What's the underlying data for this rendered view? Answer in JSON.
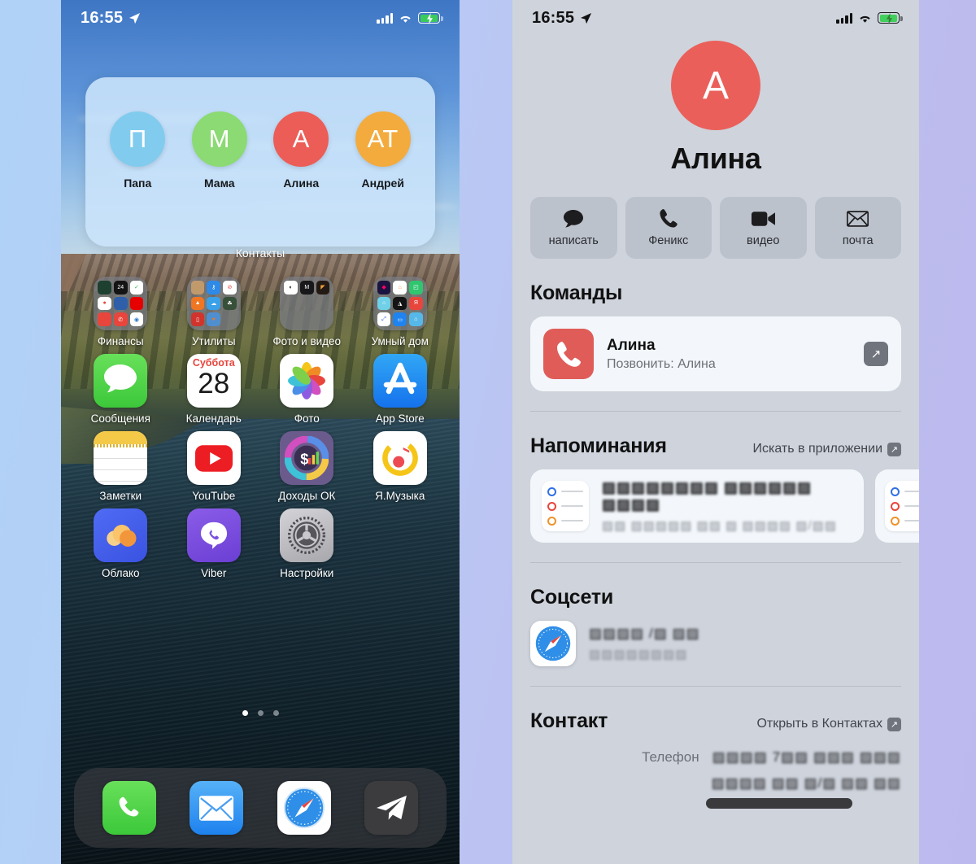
{
  "background": {
    "left_color": "#b0d2f7",
    "right_color": "#bcb9ef"
  },
  "home_screen": {
    "statusbar": {
      "time": "16:55",
      "location_icon": "location-arrow-icon",
      "signal_icon": "cellular-bars-icon",
      "wifi_icon": "wifi-icon",
      "battery_icon": "battery-charging-icon"
    },
    "widget": {
      "label": "Контакты",
      "contacts": [
        {
          "initials": "П",
          "name": "Папа",
          "color": "#81ccee"
        },
        {
          "initials": "М",
          "name": "Мама",
          "color": "#8bda74"
        },
        {
          "initials": "А",
          "name": "Алина",
          "color": "#ec5d58"
        },
        {
          "initials": "АТ",
          "name": "Андрей",
          "color": "#f3ab3e"
        }
      ]
    },
    "rows": [
      [
        {
          "label": "Финансы",
          "type": "folder",
          "minis": [
            "#1d4030",
            "#141414",
            "#ffffff",
            "#e8453c",
            "#2f5fa8",
            "#e60000",
            "#e8453c",
            "#e8453c",
            "#ffffff"
          ]
        },
        {
          "label": "Утилиты",
          "type": "folder",
          "minis": [
            "#c19a6b",
            "#2e8ae6",
            "#ffffff",
            "#ef7622",
            "#3aa0e8",
            "#37503a",
            "#d0342c",
            "#4f8fd0",
            "transparent"
          ]
        },
        {
          "label": "Фото и видео",
          "type": "folder",
          "minis": [
            "#ffffff",
            "#18181a",
            "#241a14",
            "transparent",
            "transparent",
            "transparent",
            "transparent",
            "transparent",
            "transparent"
          ]
        },
        {
          "label": "Умный дом",
          "type": "folder",
          "minis": [
            "#1b1340",
            "#ffffff",
            "#30c56f",
            "#6fd0e8",
            "#141414",
            "#e8453c",
            "#ffffff",
            "#1f83f0",
            "#56b8e8"
          ]
        }
      ],
      [
        {
          "label": "Сообщения",
          "type": "app",
          "icon": "messages-icon",
          "bg": "#5fd94f"
        },
        {
          "label": "Календарь",
          "type": "app",
          "icon": "calendar-icon",
          "bg": "#ffffff",
          "weekday": "Суббота",
          "day": "28"
        },
        {
          "label": "Фото",
          "type": "app",
          "icon": "photos-icon",
          "bg": "#ffffff"
        },
        {
          "label": "App Store",
          "type": "app",
          "icon": "appstore-icon",
          "bg": "#1f8cf0"
        }
      ],
      [
        {
          "label": "Заметки",
          "type": "app",
          "icon": "notes-icon",
          "bg": "#ffffff"
        },
        {
          "label": "YouTube",
          "type": "app",
          "icon": "youtube-icon",
          "bg": "#ffffff"
        },
        {
          "label": "Доходы ОК",
          "type": "app",
          "icon": "income-icon",
          "bg": "#6b5b8c"
        },
        {
          "label": "Я.Музыка",
          "type": "app",
          "icon": "yamusic-icon",
          "bg": "#ffffff"
        }
      ],
      [
        {
          "label": "Облако",
          "type": "app",
          "icon": "cloud-icon",
          "bg": "#4263ec"
        },
        {
          "label": "Viber",
          "type": "app",
          "icon": "viber-icon",
          "bg": "#7b51e0"
        },
        {
          "label": "Настройки",
          "type": "app",
          "icon": "settings-icon",
          "bg": "#b8b8bc"
        }
      ]
    ],
    "page_dots": {
      "count": 3,
      "active": 1
    },
    "dock": [
      {
        "label": "phone",
        "icon": "phone-icon",
        "bg": "#5fd94f"
      },
      {
        "label": "mail",
        "icon": "mail-icon",
        "bg": "#2f93f2"
      },
      {
        "label": "safari",
        "icon": "safari-icon",
        "bg": "#ffffff"
      },
      {
        "label": "telegram",
        "icon": "telegram-icon",
        "bg": "#3c3c3e"
      }
    ]
  },
  "contact_sheet": {
    "statusbar": {
      "time": "16:55",
      "location_icon": "location-arrow-icon",
      "signal_icon": "cellular-bars-icon",
      "wifi_icon": "wifi-icon",
      "battery_icon": "battery-charging-icon"
    },
    "hero": {
      "initials": "А",
      "name": "Алина",
      "avatar_color": "#eb5f5a"
    },
    "actions": [
      {
        "label": "написать",
        "icon": "message-bubble-icon"
      },
      {
        "label": "Феникс",
        "icon": "phone-handset-icon"
      },
      {
        "label": "видео",
        "icon": "video-camera-icon"
      },
      {
        "label": "почта",
        "icon": "envelope-icon"
      }
    ],
    "shortcuts_section": {
      "title": "Команды",
      "card": {
        "title": "Алина",
        "subtitle": "Позвонить: Алина",
        "icon": "phone-handset-icon",
        "icon_color": "#e05c58",
        "open_icon": "open-external-icon"
      }
    },
    "reminders_section": {
      "title": "Напоминания",
      "link": "Искать в приложении",
      "link_icon": "open-external-icon",
      "card": {
        "title_redacted": "▨▨▨▨▨▨▨▨  ▨▨▨▨▨▨  ▨▨▨▨",
        "subtitle_redacted": "▨▨ ▨▨▨▨▨ ▨▨ ▨ ▨▨▨▨ ▨/▨▨"
      }
    },
    "social_section": {
      "title": "Соцсети",
      "item": {
        "icon": "safari-icon",
        "line1_redacted": "▨▨▨▨ /▨ ▨▨",
        "line2_redacted": "▨▨▨▨▨▨▨▨"
      }
    },
    "contact_section": {
      "title": "Контакт",
      "link": "Открыть в Контактах",
      "link_icon": "open-external-icon",
      "fields": [
        {
          "label": "Телефон",
          "value_redacted": "▨▨▨▨ 7▨▨ ▨▨▨ ▨▨▨"
        },
        {
          "label": "",
          "value_redacted": "▨▨▨▨ ▨▨ ▨/▨ ▨▨ ▨▨"
        }
      ],
      "redaction_bar": true
    }
  }
}
